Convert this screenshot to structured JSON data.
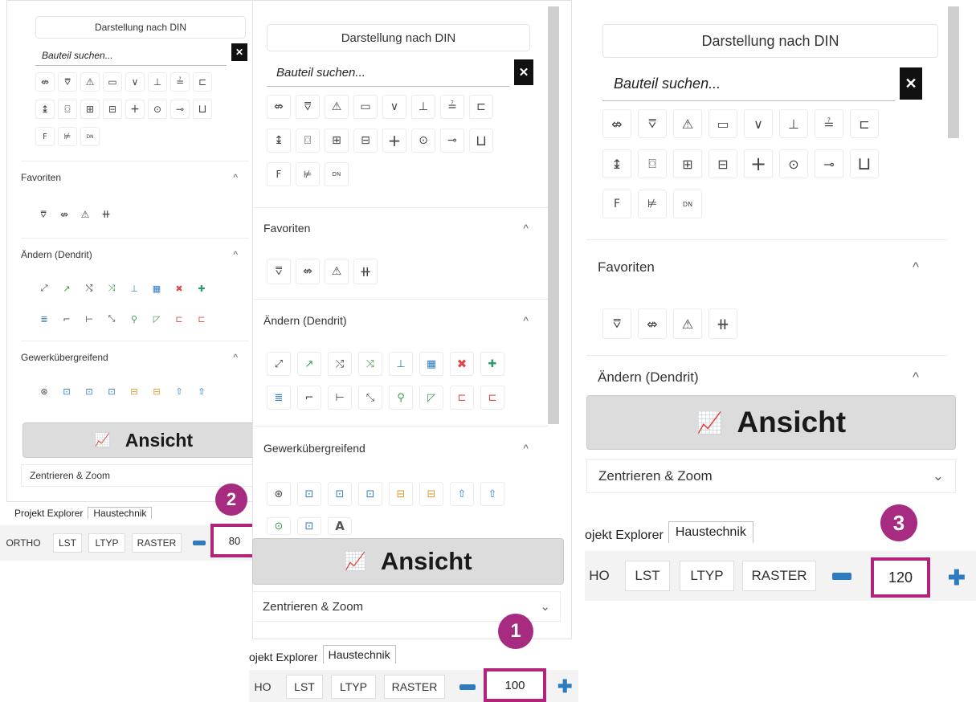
{
  "din_label": "Darstellung nach DIN",
  "search_placeholder": "Bauteil suchen...",
  "close_symbol": "✕",
  "sections": {
    "favoriten": "Favoriten",
    "aendern": "Ändern (Dendrit)",
    "gewerk": "Gewerkübergreifend",
    "zentrieren": "Zentrieren & Zoom"
  },
  "ansicht_label": "Ansicht",
  "tabs": {
    "projekt_explorer": "Projekt Explorer",
    "projekt_explorer_partial": "ojekt Explorer",
    "haustechnik": "Haustechnik"
  },
  "statusbar": {
    "ortho": "ORTHO",
    "ortho_partial": "HO",
    "lst": "LST",
    "ltyp": "LTYP",
    "raster": "RASTER"
  },
  "zoom_values": {
    "panel_80": "80",
    "panel_100": "100",
    "panel_120": "120"
  },
  "badges": {
    "b1": "1",
    "b2": "2",
    "b3": "3"
  },
  "din_icons_row1": [
    "⇎",
    "⩢",
    "⚠",
    "▭",
    "∨",
    "⊥",
    "≟",
    "⊏"
  ],
  "din_icons_row2": [
    "↨",
    "⌼",
    "⊞",
    "⊟",
    "+",
    "⊙",
    "⊸",
    "⊔"
  ],
  "din_icons_row3": [
    "F",
    "⊭",
    "DN"
  ],
  "fav_icons": [
    "⩢",
    "⇎",
    "⚠",
    "⧺"
  ],
  "aendern_row1": [
    "⤢",
    "↗",
    "⤭",
    "⤨",
    "⊥",
    "▦",
    "✖",
    "✚"
  ],
  "aendern_row2": [
    "≣",
    "⌐",
    "⊢",
    "⤡",
    "⚲",
    "◸",
    "⊏",
    "⊏"
  ],
  "gewerk_row1": [
    "⊛",
    "⊡",
    "⊡",
    "⊡",
    "⊟",
    "⊟",
    "⇧",
    "⇧"
  ],
  "gewerk_row2": [
    "⊙",
    "⊡",
    "A"
  ],
  "ansicht_glyph": "📈",
  "chevron_up": "^",
  "chevron_down": "⌄",
  "plus_glyph": "✚",
  "colors": {
    "badge": "#a82b82",
    "highlight": "#b0247a",
    "accent_blue": "#2e7bbf"
  }
}
